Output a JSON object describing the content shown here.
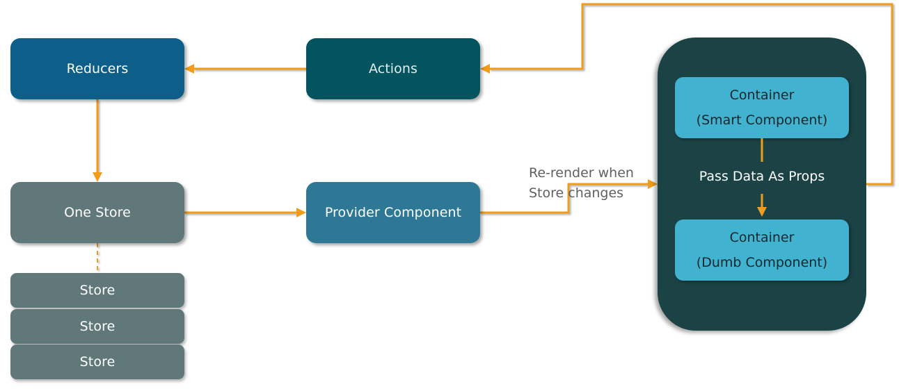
{
  "diagram": {
    "nodes": {
      "reducers": "Reducers",
      "actions": "Actions",
      "one_store": "One Store",
      "provider": "Provider Component",
      "stores": [
        "Store",
        "Store",
        "Store"
      ],
      "smart_container": {
        "line1": "Container",
        "line2": "(Smart Component)"
      },
      "dumb_container": {
        "line1": "Container",
        "line2": "(Dumb Component)"
      }
    },
    "labels": {
      "rerender_line1": "Re-render when",
      "rerender_line2": "Store changes",
      "pass_props": "Pass Data As Props"
    },
    "colors": {
      "arrow": "#f29c1c",
      "reducers": "#0d5e88",
      "actions": "#03545f",
      "store": "#61787a",
      "provider": "#2f7895",
      "panel": "#1b4244",
      "container": "#41b3d0"
    },
    "edges": [
      {
        "from": "Actions",
        "to": "Reducers"
      },
      {
        "from": "Reducers",
        "to": "One Store"
      },
      {
        "from": "One Store",
        "to": "Provider Component"
      },
      {
        "from": "Provider Component",
        "to": "Components Panel",
        "label": "Re-render when Store changes"
      },
      {
        "from": "Components Panel",
        "to": "Actions"
      },
      {
        "from": "Container (Smart Component)",
        "to": "Container (Dumb Component)",
        "label": "Pass Data As Props"
      },
      {
        "from": "One Store",
        "to": "Store",
        "style": "dashed"
      }
    ]
  }
}
